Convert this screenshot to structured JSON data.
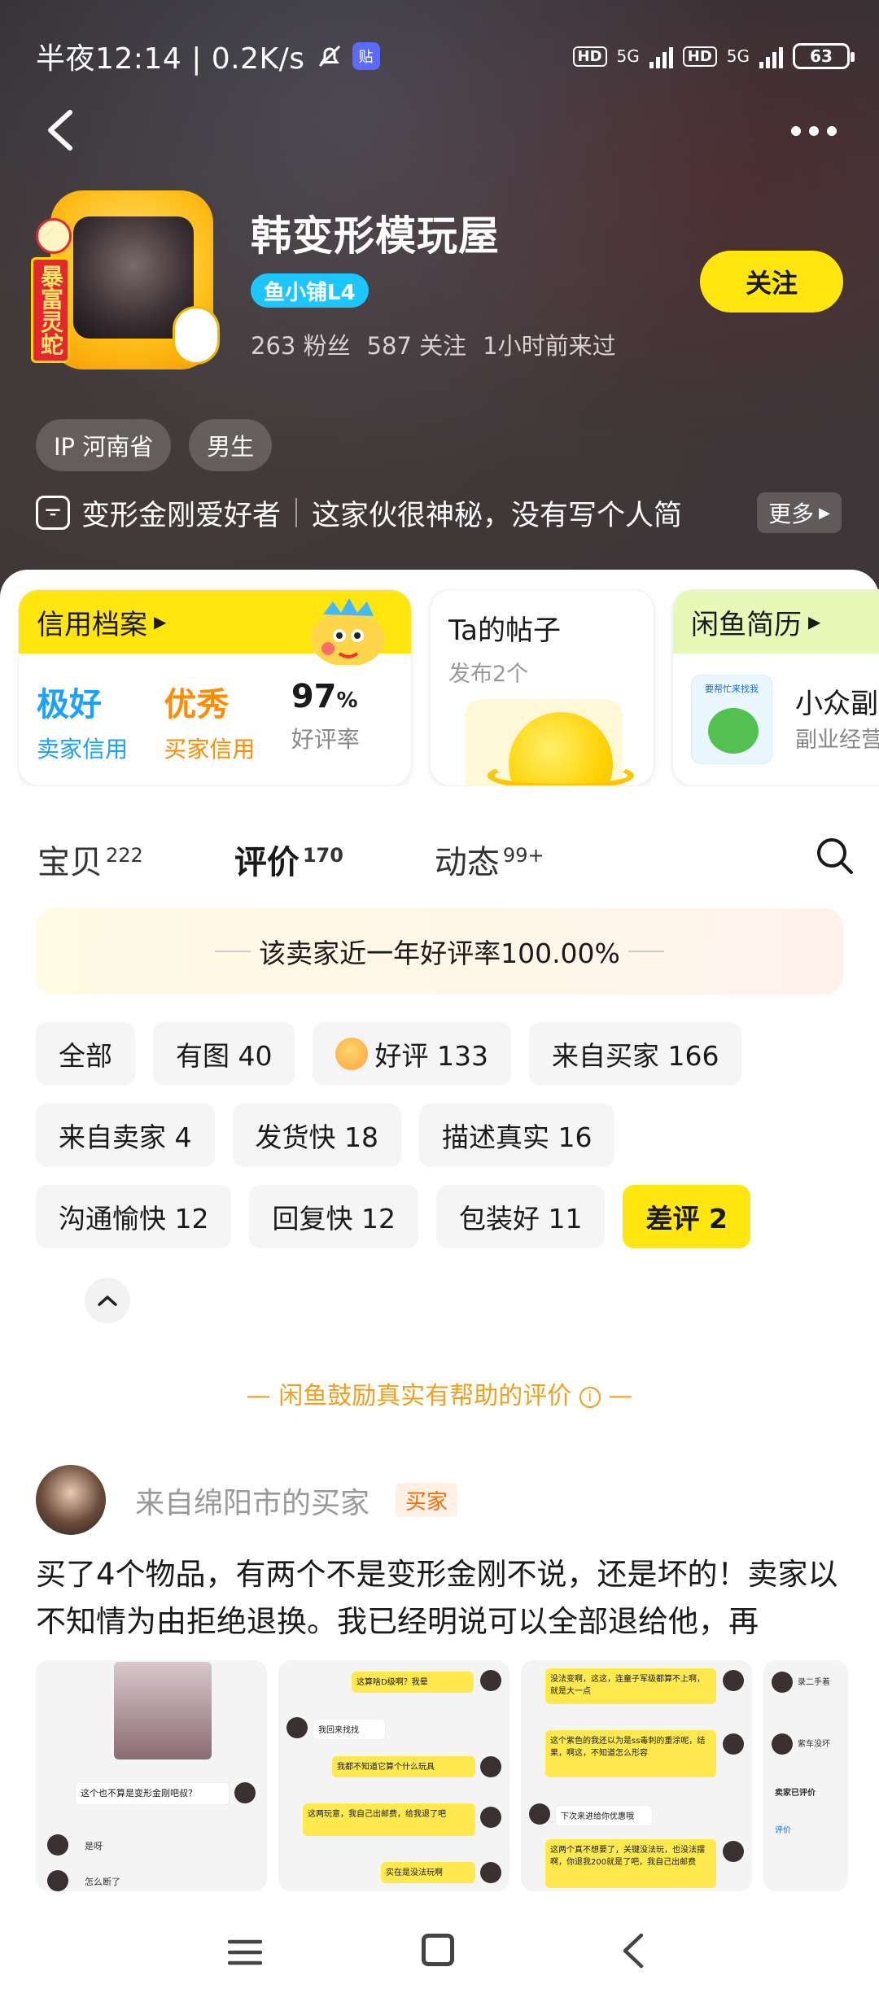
{
  "status_bar": {
    "time": "半夜12:14 | 0.2K/s",
    "network_1": "5G",
    "network_2": "5G",
    "hd_1": "HD",
    "hd_2": "HD",
    "battery": "63",
    "post_badge": "贴"
  },
  "shop": {
    "name": "韩变形模玩屋",
    "level": "鱼小铺L4",
    "fans": "263 粉丝",
    "following": "587 关注",
    "last_seen": "1小时前来过",
    "follow_label": "关注",
    "avatar_banner": "暴富灵蛇",
    "tags": [
      "IP 河南省",
      "男生"
    ],
    "bio_title": "变形金刚爱好者",
    "bio_text": "这家伙很神秘，没有写个人简",
    "more_label": "更多"
  },
  "cards": {
    "credit": {
      "title": "信用档案",
      "items": [
        {
          "value": "极好",
          "label": "卖家信用"
        },
        {
          "value": "优秀",
          "label": "买家信用"
        },
        {
          "value": "97",
          "unit": "%",
          "label": "好评率"
        }
      ]
    },
    "posts": {
      "title": "Ta的帖子",
      "subtitle": "发布2个"
    },
    "resume": {
      "title": "闲鱼简历",
      "item_title": "小众副业",
      "item_sub": "副业经营",
      "thumb_text": "要帮忙来找我"
    }
  },
  "tabs": [
    {
      "label": "宝贝",
      "count": "222"
    },
    {
      "label": "评价",
      "count": "170"
    },
    {
      "label": "动态",
      "count": "99+"
    }
  ],
  "rating_banner": "该卖家近一年好评率100.00%",
  "filters": [
    [
      "全部",
      "有图 40",
      "好评 133",
      "来自买家 166"
    ],
    [
      "来自卖家 4",
      "发货快 18",
      "描述真实 16"
    ],
    [
      "沟通愉快 12",
      "回复快 12",
      "包装好 11",
      "差评 2"
    ]
  ],
  "encourage_text": "闲鱼鼓励真实有帮助的评价",
  "review": {
    "reviewer": "来自绵阳市的买家",
    "badge": "买家",
    "text": "买了4个物品，有两个不是变形金刚不说，还是坏的！卖家以不知情为由拒绝退换。我已经明说可以全部退给他，再",
    "images": [
      {
        "lines": [
          "这个也不算是变形金刚吧叔？",
          "是呀",
          "怎么断了"
        ]
      },
      {
        "lines": [
          "这算啥D级啊？我晕",
          "我回来找找",
          "我都不知道它算个什么玩具",
          "这两玩意，我自己出邮费，给我退了吧",
          "实在是没法玩啊"
        ]
      },
      {
        "lines": [
          "没法变啊，这这，连童子军级都算不上啊，就是大一点",
          "这个紫色的我还以为是ss毒刺的重涂呢，结果，啊这，不知道怎么形容",
          "下次来进给你优惠哦",
          "这两个真不想要了，关键没法玩，也没法摆啊，你退我200就是了吧，我自己出邮费"
        ]
      },
      {
        "lines": [
          "录二手着",
          "紫车没坏",
          "卖家已评价",
          "评价"
        ]
      }
    ]
  },
  "colors": {
    "accent_yellow": "#ffe60f",
    "credit_blue": "#1aa0ff",
    "credit_orange": "#ff8c00",
    "encourage_orange": "#f0a020"
  }
}
